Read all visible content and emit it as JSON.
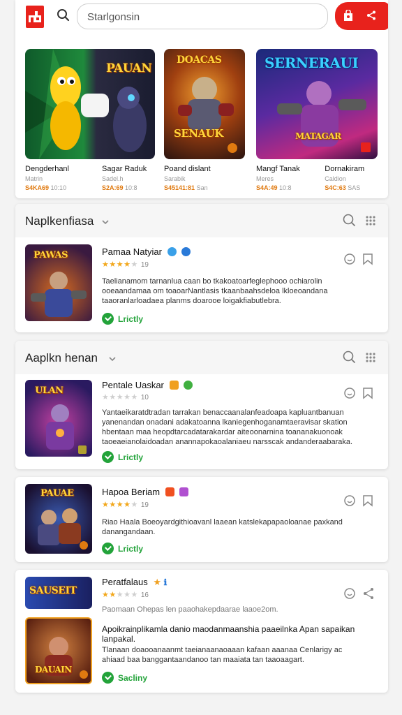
{
  "search": {
    "placeholder": "Starlgonsin"
  },
  "featured": [
    {
      "title": "Dengderhanl",
      "sub": "Matrin",
      "price": "S4KA69",
      "price_extra": "10:10",
      "art_text": "PAUAN"
    },
    {
      "title": "Sagar Raduk",
      "sub": "Sadel.h",
      "price": "S2A:69",
      "price_extra": "10:8",
      "art_text": "SENAUK"
    },
    {
      "title": "Poand dislant",
      "sub": "Sarabik",
      "price": "S45141:81",
      "price_extra": "San",
      "art_text": "DOACAS"
    },
    {
      "title": "Mangf Tanak",
      "sub": "Meres",
      "price": "S4A:49",
      "price_extra": "10:8",
      "art_text": "SERNERAUI"
    },
    {
      "title": "Dornakiram",
      "sub": "Caldion",
      "price": "S4C:63",
      "price_extra": "SAS",
      "art_text": "MATAGAR"
    }
  ],
  "sections": [
    {
      "title": "Naplkenfiasa"
    },
    {
      "title": "Aaplkn henan"
    }
  ],
  "apps": [
    {
      "name": "Pamaa Natyiar",
      "count": "19",
      "desc": "Taelianamom tarnanlua caan bo tkakoatoarfeglephooo ochiarolin ooeaandamaa om toaoarNantlasis tkaanbaahsdeloa lkloeoandana taaoranlarloadaea planms doarooe loigakfiabutlebra.",
      "status": "Lrictly",
      "icon_text": "PAWAS"
    },
    {
      "name": "Pentale Uaskar",
      "count": "10",
      "desc": "Yantaeikaratdtradan tarrakan benaccaanalanfeadoapa kapluantbanuan yanenandan onadani adakatoanna lkaniegenhoganamtaeravisar skation hbentaan maa heopdtarcadatarakardar aiteoonarnina toananakuonoak taoeaeianolaidoadan anannapokaoalaniaeu narsscak andanderaabaraka.",
      "status": "Lrictly",
      "icon_text": "ULAN"
    },
    {
      "name": "Hapoa Beriam",
      "count": "19",
      "desc": "Riao Haala Boeoyardgithioavanl laaean katslekapapaoloanae paxkand danangandaan.",
      "status": "Lrictly",
      "icon_text": "PAUAE"
    },
    {
      "name": "Peratfalaus",
      "count": "16",
      "desc": "Paomaan Ohepas len paaohakepdaarae laaoe2om.",
      "headline": "Apoikrainplikamla danio maodanmaanshia paaeilnka Apan sapaikan lanpakal.",
      "desc2": "Tlanaan doaooanaanmt taeianaanaoaaan kafaan aaanaa Cenlarigy ac ahiaad baa banggantaandanoo tan maaiata tan taaoaagart.",
      "status": "Sacliny",
      "icon_text": "SAUSEIT",
      "icon2_text": "DAUAIN"
    }
  ],
  "colors": {
    "accent": "#e8221c",
    "star": "#f2a71b",
    "ok": "#23a33a"
  }
}
